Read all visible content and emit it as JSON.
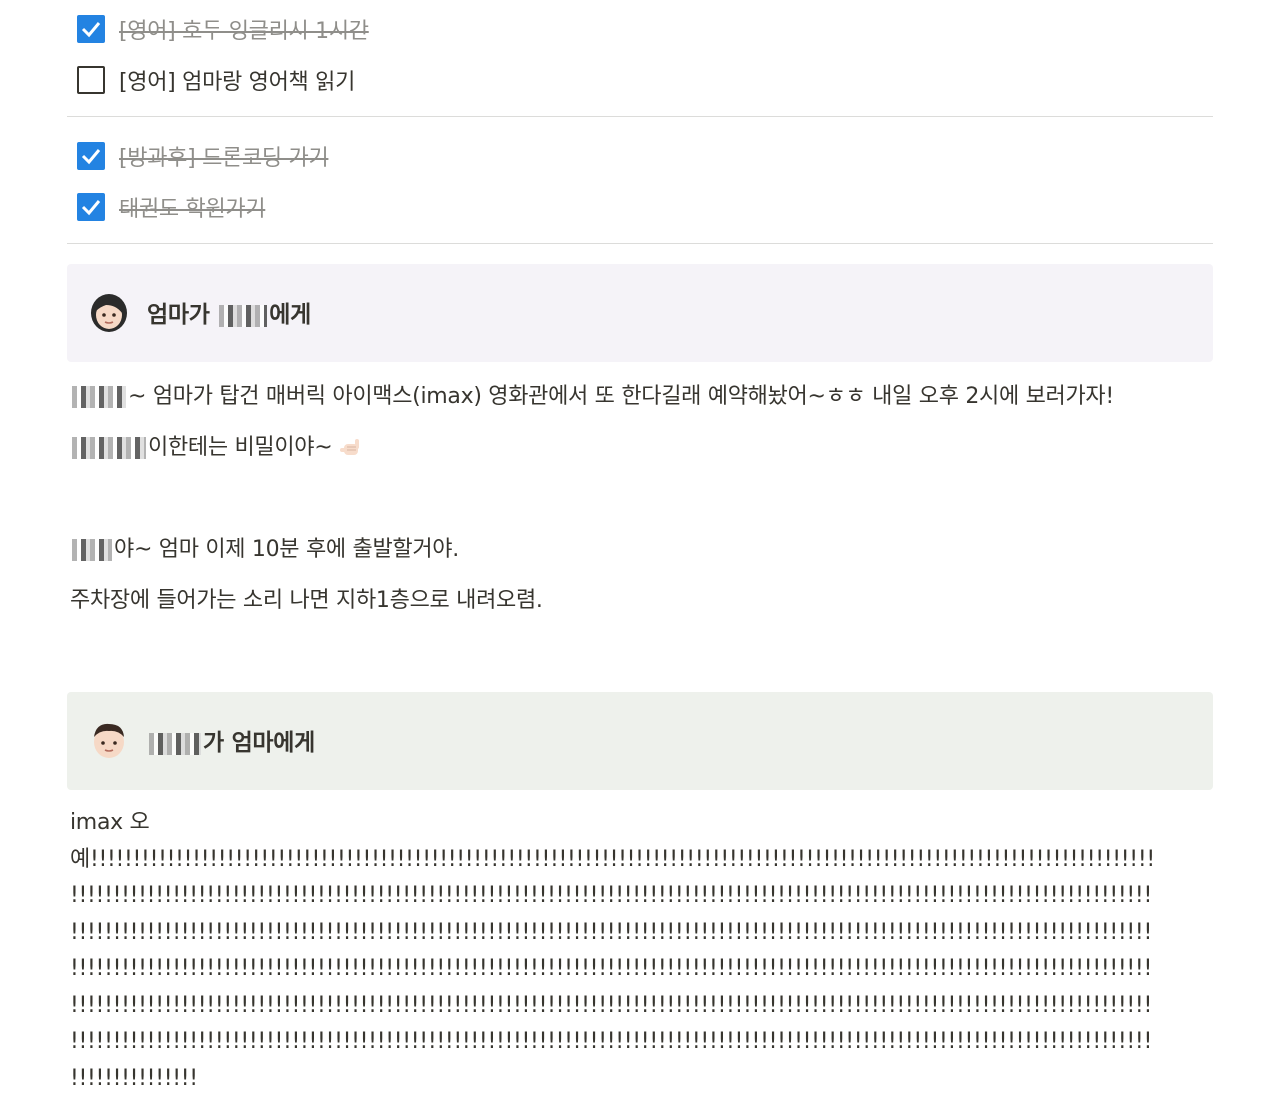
{
  "todos_group1": [
    {
      "text": "[영어] 호두 잉글리시 1시간",
      "checked": true
    },
    {
      "text": "[영어] 엄마랑 영어책 읽기",
      "checked": false
    }
  ],
  "todos_group2": [
    {
      "text": "[방과후] 드론코딩 가기",
      "checked": true
    },
    {
      "text": "태권도 학원가기",
      "checked": true
    }
  ],
  "callout_mom": {
    "emoji": "woman-face-icon",
    "title_prefix": "엄마가 ",
    "title_suffix": "에게",
    "color": "#f5f3f8"
  },
  "mom_message": {
    "line1_text": "~ 엄마가 탑건 매버릭 아이맥스(imax) 영화관에서 또 한다길래 예약해놨어~ㅎㅎ 내일 오후 2시에 보러가자!",
    "line2_text": "이한테는 비밀이야~",
    "line2_emoji": "call-me-hand-icon",
    "line3_text": "야~ 엄마 이제 10분 후에 출발할거야.",
    "line4_text": "주차장에 들어가는 소리 나면 지하1층으로 내려오렴."
  },
  "callout_kid": {
    "emoji": "boy-face-icon",
    "title_suffix": "가 엄마에게",
    "color": "#eef1ec"
  },
  "kid_message": {
    "line1": "imax 오",
    "line2": "예!!!!!!!!!!!!!!!!!!!!!!!!!!!!!!!!!!!!!!!!!!!!!!!!!!!!!!!!!!!!!!!!!!!!!!!!!!!!!!!!!!!!!!!!!!!!!!!!!!!!!!!!!!!!!!!!!!!!!!!!!!!!!",
    "line3": "!!!!!!!!!!!!!!!!!!!!!!!!!!!!!!!!!!!!!!!!!!!!!!!!!!!!!!!!!!!!!!!!!!!!!!!!!!!!!!!!!!!!!!!!!!!!!!!!!!!!!!!!!!!!!!!!!!!!!!!!!!!!!!!",
    "line4": "!!!!!!!!!!!!!!!!!!!!!!!!!!!!!!!!!!!!!!!!!!!!!!!!!!!!!!!!!!!!!!!!!!!!!!!!!!!!!!!!!!!!!!!!!!!!!!!!!!!!!!!!!!!!!!!!!!!!!!!!!!!!!!!",
    "line5": "!!!!!!!!!!!!!!!!!!!!!!!!!!!!!!!!!!!!!!!!!!!!!!!!!!!!!!!!!!!!!!!!!!!!!!!!!!!!!!!!!!!!!!!!!!!!!!!!!!!!!!!!!!!!!!!!!!!!!!!!!!!!!!!",
    "line6": "!!!!!!!!!!!!!!!!!!!!!!!!!!!!!!!!!!!!!!!!!!!!!!!!!!!!!!!!!!!!!!!!!!!!!!!!!!!!!!!!!!!!!!!!!!!!!!!!!!!!!!!!!!!!!!!!!!!!!!!!!!!!!!!",
    "line7": "!!!!!!!!!!!!!!!!!!!!!!!!!!!!!!!!!!!!!!!!!!!!!!!!!!!!!!!!!!!!!!!!!!!!!!!!!!!!!!!!!!!!!!!!!!!!!!!!!!!!!!!!!!!!!!!!!!!!!!!!!!!!!!!",
    "line8": "!!!!!!!!!!!!!!!"
  },
  "colors": {
    "checkbox_checked": "#2383e2",
    "text": "#37352f",
    "muted_text": "#8f8e8a"
  }
}
